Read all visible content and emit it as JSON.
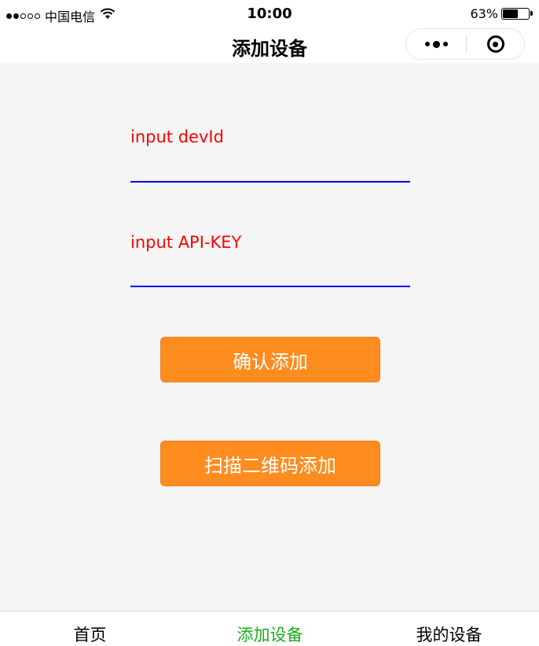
{
  "status_bar": {
    "carrier": "中国电信",
    "wifi_icon": "wifi-icon",
    "time": "10:00",
    "battery_text": "63%",
    "battery_level": 0.63
  },
  "nav": {
    "title": "添加设备",
    "more_icon": "more-dots-icon",
    "close_icon": "target-circle-icon"
  },
  "form": {
    "devid_label": "input devId",
    "devid_value": "",
    "apikey_label": "input API-KEY",
    "apikey_value": "",
    "input_underline_color": "#0000ee",
    "label_color": "#ff0000"
  },
  "buttons": {
    "confirm_label": "确认添加",
    "scan_label": "扫描二维码添加",
    "button_color": "#ff8c1f"
  },
  "tab_bar": {
    "tabs": [
      {
        "label": "首页",
        "active": false
      },
      {
        "label": "添加设备",
        "active": true
      },
      {
        "label": "我的设备",
        "active": false
      }
    ],
    "active_color": "#1aad19"
  }
}
